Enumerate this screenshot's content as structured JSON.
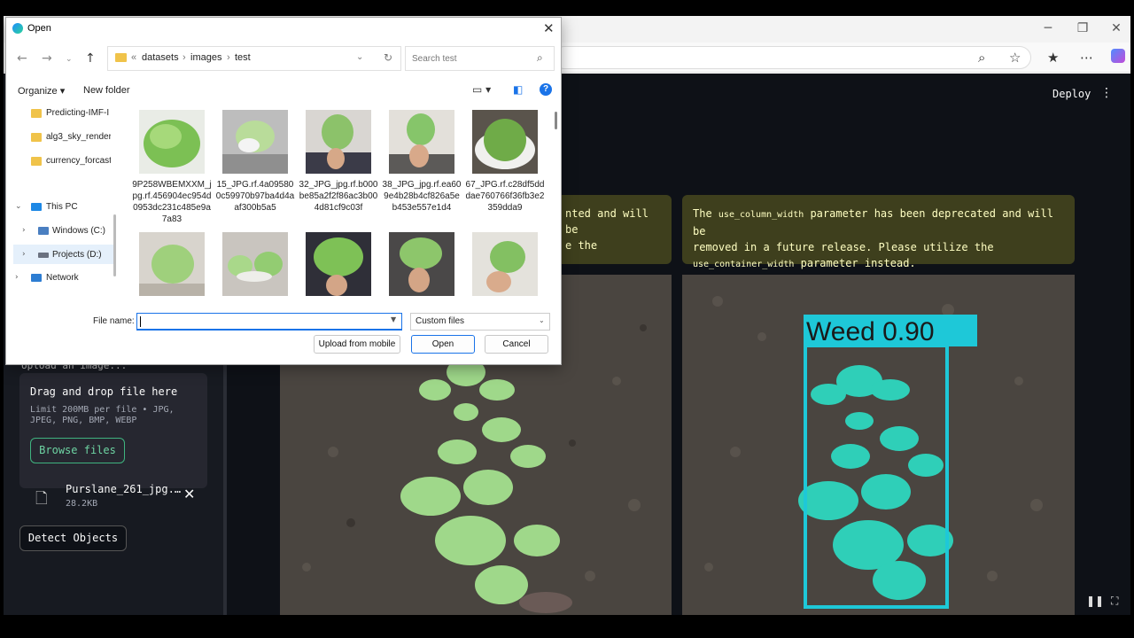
{
  "browser": {
    "address_icons": [
      "zoom-icon",
      "star-icon",
      "favorites-icon",
      "more-icon",
      "copilot-icon"
    ]
  },
  "app": {
    "deploy_label": "Deploy",
    "uploader": {
      "label_partial": "Upload an image...",
      "drop_title": "Drag and drop file here",
      "limit_text": "Limit 200MB per file • JPG, JPEG, PNG, BMP, WEBP",
      "browse_label": "Browse files",
      "file_name": "Purslane_261_jpg.…",
      "file_size": "28.2KB"
    },
    "detect_label": "Detect Objects",
    "warning_left_partial": [
      "nted and will be",
      "e the"
    ],
    "warning_right": {
      "line1_prefix": "The ",
      "line1_code": "use_column_width",
      "line1_suffix": " parameter has been deprecated and will be",
      "line2": "removed in a future release. Please utilize the",
      "line3_code": "use_container_width",
      "line3_suffix": " parameter instead."
    },
    "detection": {
      "label": "Weed 0.90",
      "class": "Weed",
      "confidence": 0.9,
      "color": "#1ec8d8"
    }
  },
  "dialog": {
    "title": "Open",
    "breadcrumb": [
      "datasets",
      "images",
      "test"
    ],
    "search_placeholder": "Search test",
    "organize_label": "Organize ▾",
    "new_folder_label": "New folder",
    "nav": {
      "folders": [
        "Predicting-IMF-I",
        "alg3_sky_render",
        "currency_forcast"
      ],
      "this_pc": "This PC",
      "drives": [
        "Windows (C:)",
        "Projects (D:)"
      ],
      "network": "Network"
    },
    "files": [
      {
        "name": "9P258WBEMXXM_jpg.rf.456904ec954d0953dc231c485e9a7a83"
      },
      {
        "name": "15_JPG.rf.4a095800c59970b97ba4d4aaf300b5a5"
      },
      {
        "name": "32_JPG_jpg.rf.b000be85a2f2f86ac3b004d81cf9c03f"
      },
      {
        "name": "38_JPG_jpg.rf.ea609e4b28b4cf826a5eb453e557e1d4"
      },
      {
        "name": "67_JPG.rf.c28df5dddae760766f36fb3e2359dda9"
      }
    ],
    "file_name_label": "File name:",
    "file_name_value": "",
    "file_type": "Custom files",
    "upload_mobile_label": "Upload from mobile",
    "open_label": "Open",
    "cancel_label": "Cancel"
  }
}
